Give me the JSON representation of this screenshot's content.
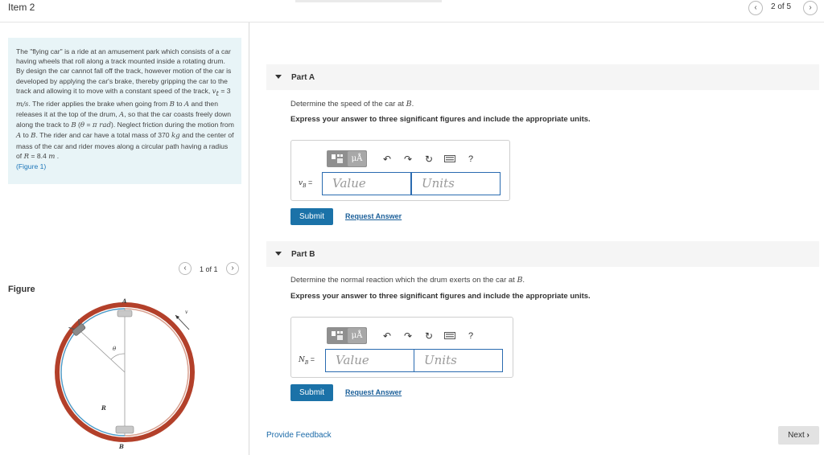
{
  "header": {
    "item_title": "Item 2",
    "page_count": "2 of 5",
    "prev_icon": "chevron-left-icon",
    "next_icon": "chevron-right-icon"
  },
  "problem": {
    "p1": "The \"flying car\" is a ride at an amusement park which consists of a car having wheels that roll along a track mounted inside a rotating drum. By design the car cannot fall off the track, however motion of the car is developed by applying the car's brake, thereby gripping the car to the track and allowing it to move with a constant speed of the track, ",
    "vt": "v",
    "vt_sub": "t",
    "p2": " = 3 ",
    "unit_speed": "m/s",
    "p3": ". The rider applies the brake when going from ",
    "B1": "B",
    "p4": " to ",
    "A1": "A",
    "p5": " and then releases it at the top of the drum, ",
    "A2": "A",
    "p6": ", so that the car coasts freely down along the track to ",
    "B2": "B",
    "p7": " (",
    "theta": "θ",
    "p8": " = ",
    "pi": "π",
    "rad": " rad",
    "p9": "). Neglect friction during the motion from ",
    "A3": "A",
    "p10": " to ",
    "B3": "B",
    "p11": ". The rider and car have a total mass of 370 ",
    "kg": "kg",
    "p12": " and the center of mass of the car and rider moves along a circular path having a radius of ",
    "R": "R",
    "p13": " = 8.4 ",
    "m": "m",
    "p14": " .",
    "figure_link": "(Figure 1)"
  },
  "figure": {
    "label": "Figure",
    "count": "1 of 1",
    "labels": {
      "A": "A",
      "B": "B",
      "R": "R",
      "theta": "θ",
      "vt": "v"
    },
    "colors": {
      "drum": "#b3402a",
      "track": "#3aa0d8",
      "line": "#999999"
    }
  },
  "partA": {
    "title": "Part A",
    "question_prefix": "Determine the speed of the car at ",
    "question_var": "B",
    "question_suffix": ".",
    "instruction": "Express your answer to three significant figures and include the appropriate units.",
    "var_label": "v",
    "var_sub": "B",
    "var_eq": " =",
    "value_placeholder": "Value",
    "units_placeholder": "Units",
    "submit": "Submit",
    "request": "Request Answer"
  },
  "partB": {
    "title": "Part B",
    "question_prefix": "Determine the normal reaction which the drum exerts on the car at ",
    "question_var": "B",
    "question_suffix": ".",
    "instruction": "Express your answer to three significant figures and include the appropriate units.",
    "var_label": "N",
    "var_sub": "B",
    "var_eq": " =",
    "value_placeholder": "Value",
    "units_placeholder": "Units",
    "submit": "Submit",
    "request": "Request Answer"
  },
  "toolbar": {
    "mu": "μÅ",
    "help": "?",
    "icons": [
      "templates-icon",
      "symbols-icon",
      "undo-icon",
      "redo-icon",
      "reset-icon",
      "keyboard-icon",
      "help-icon"
    ]
  },
  "footer": {
    "feedback": "Provide Feedback",
    "next": "Next"
  },
  "colors": {
    "accent": "#1b72a8",
    "link": "#1b74b8",
    "problem_bg": "#e8f4f7"
  }
}
